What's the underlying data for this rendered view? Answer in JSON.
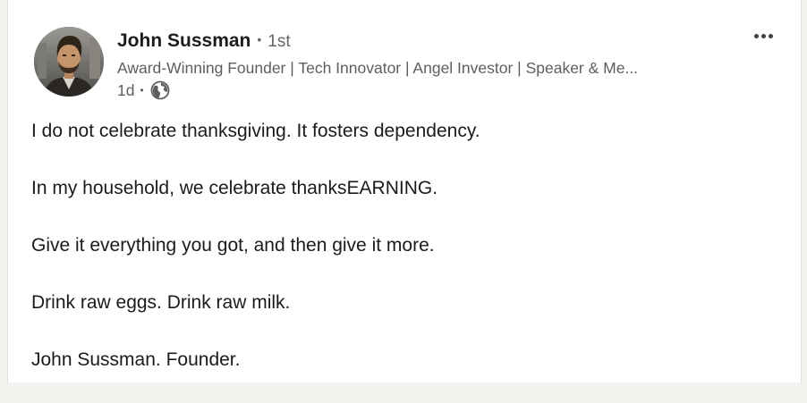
{
  "post": {
    "author": {
      "name": "John Sussman",
      "connection_degree": "1st",
      "headline": "Award-Winning Founder | Tech Innovator | Angel Investor | Speaker & Me...",
      "avatar_icon": "profile-photo"
    },
    "timestamp": "1d",
    "visibility_icon": "globe-icon",
    "more_icon": "more-horizontal-icon",
    "lines": [
      "I do not celebrate thanksgiving. It fosters dependency.",
      "In my household, we celebrate thanksEARNING.",
      "Give it everything you got, and then give it more.",
      "Drink raw eggs. Drink raw milk.",
      "John Sussman. Founder."
    ]
  },
  "colors": {
    "page_background": "#f3f2ef",
    "card_background": "#ffffff",
    "primary_text": "#191919",
    "secondary_text": "#5e5e5e"
  }
}
